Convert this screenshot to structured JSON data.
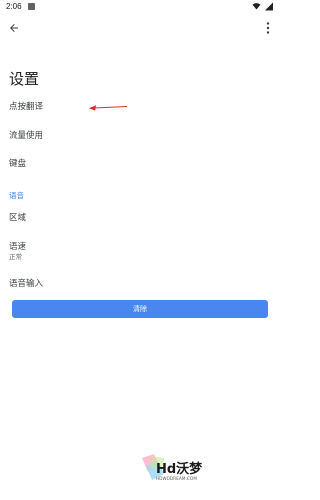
{
  "status_bar": {
    "time": "2:06"
  },
  "icons": {
    "back": "arrow-back-icon",
    "more": "more-vert-icon",
    "wifi": "wifi-icon",
    "battery": "battery-icon",
    "notification": "notification-icon"
  },
  "page": {
    "title": "设置"
  },
  "settings": {
    "tap_to_translate": "点按翻译",
    "data_usage": "流量使用",
    "keyboard": "键盘",
    "speech_section": "语音",
    "region": "区域",
    "speech_rate": "语速",
    "speech_rate_value": "正常",
    "speech_input": "语音输入"
  },
  "actions": {
    "clear_label": "清除"
  },
  "watermark": {
    "title": "Hd沃梦",
    "subtitle": "HDWODREAM.COM"
  },
  "colors": {
    "accent": "#4285f4",
    "button": "#4a86f0",
    "annotation_arrow": "#d93025"
  }
}
